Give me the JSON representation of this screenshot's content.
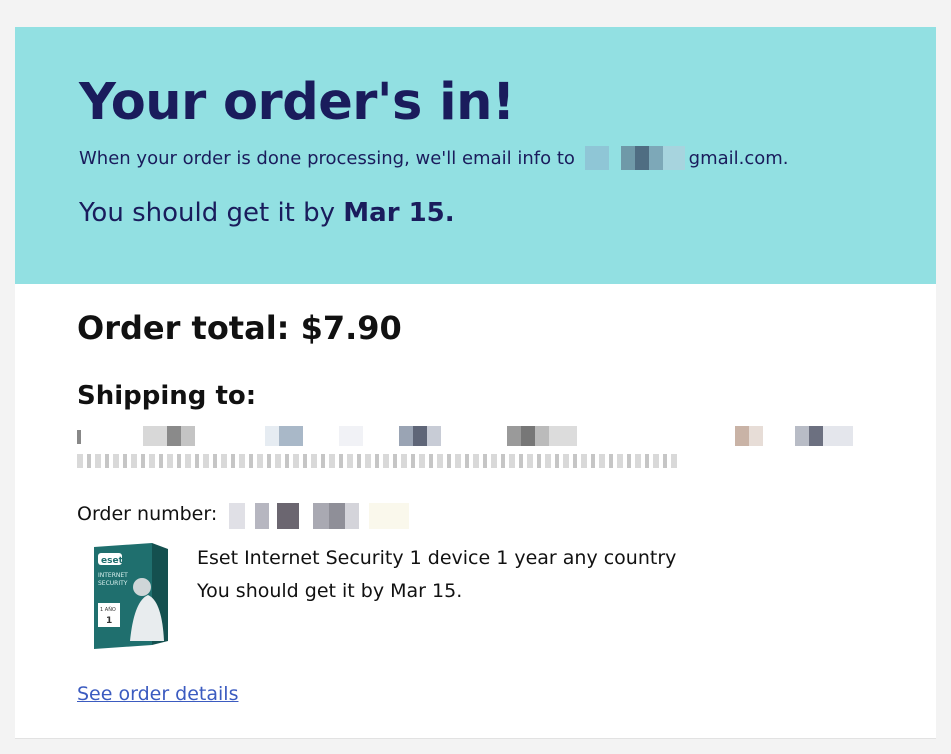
{
  "banner": {
    "title": "Your order's in!",
    "email_prefix": "When your order is done processing, we'll email info to",
    "email_domain": "gmail.com.",
    "eta_prefix": "You should get it by",
    "eta_date": "Mar 15."
  },
  "order": {
    "total_label": "Order total: $7.90",
    "shipping_label": "Shipping to:",
    "order_number_label": "Order number:"
  },
  "product": {
    "title": "Eset Internet Security 1 device 1 year any country",
    "eta": "You should get it by Mar 15.",
    "image_icon": "eset-product-box",
    "box_text": [
      "eset",
      "INTERNET",
      "SECURITY",
      "1 AÑO",
      "1"
    ]
  },
  "links": {
    "see_order_details": "See order details"
  },
  "colors": {
    "banner_bg": "#92e0e2",
    "banner_text": "#1a1c5c",
    "link": "#3b5bc0"
  }
}
